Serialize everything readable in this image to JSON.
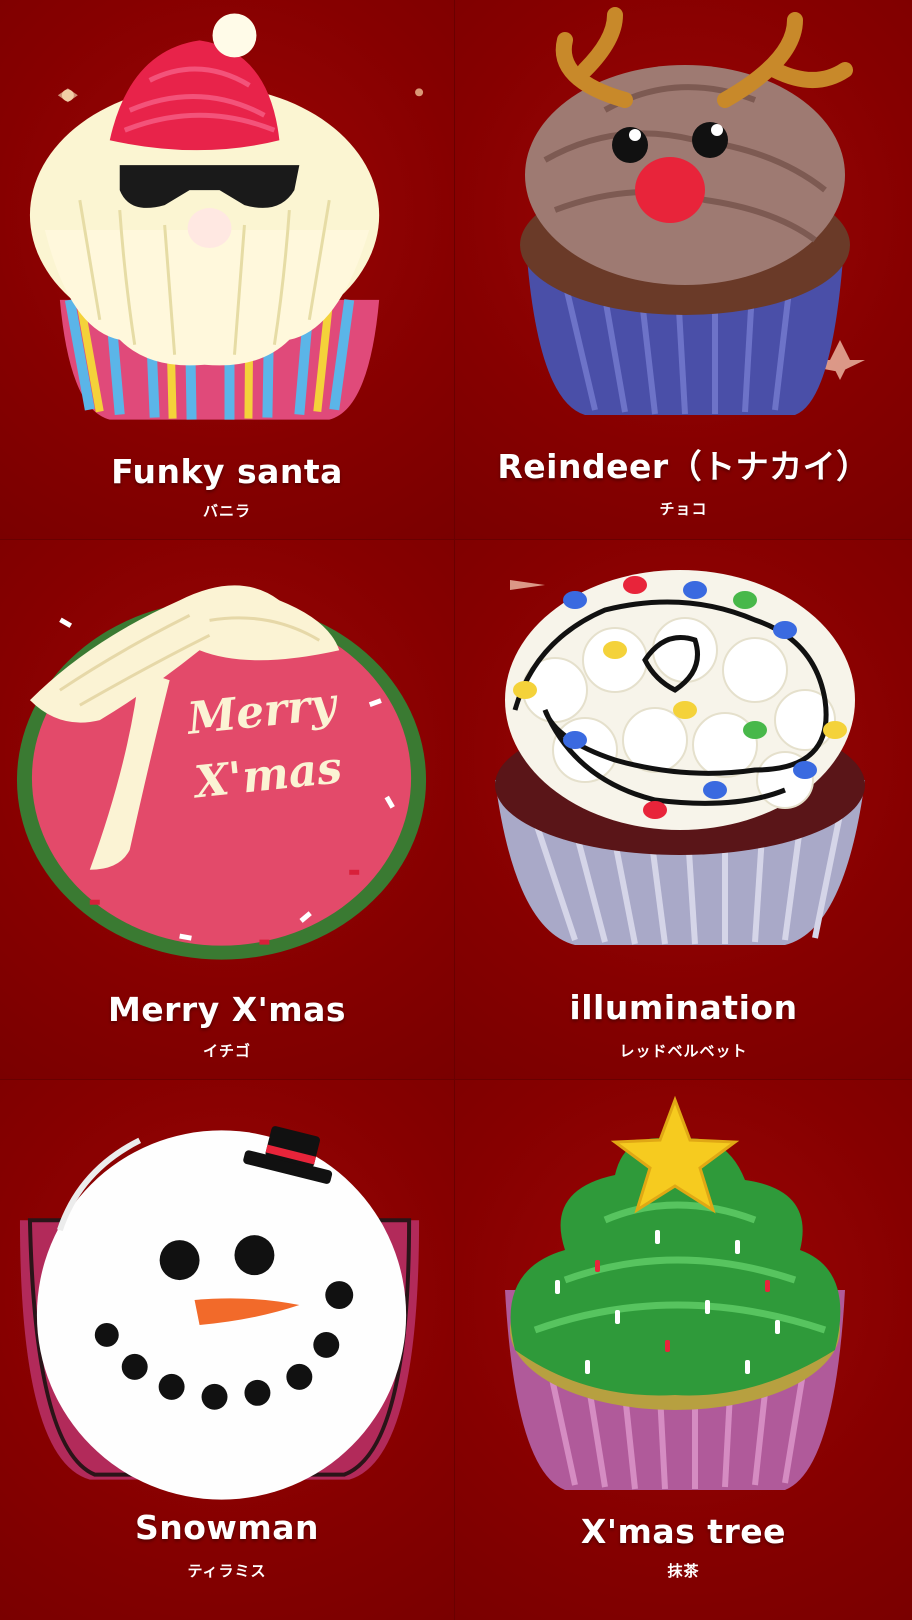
{
  "cupcakes": [
    {
      "name": "Funky santa",
      "flavor": "バニラ",
      "icon": "santa-cupcake-icon"
    },
    {
      "name": "Reindeer（トナカイ）",
      "flavor": "チョコ",
      "icon": "reindeer-cupcake-icon"
    },
    {
      "name": "Merry X'mas",
      "flavor": "イチゴ",
      "icon": "merry-xmas-cupcake-icon"
    },
    {
      "name": "illumination",
      "flavor": "レッドベルベット",
      "icon": "illumination-cupcake-icon"
    },
    {
      "name": "Snowman",
      "flavor": "ティラミス",
      "icon": "snowman-cupcake-icon"
    },
    {
      "name": "X'mas tree",
      "flavor": "抹茶",
      "icon": "xmas-tree-cupcake-icon"
    }
  ],
  "decoration_text": "Merry X'mas",
  "colors": {
    "background": "#8a0000",
    "text": "#ffffff"
  }
}
